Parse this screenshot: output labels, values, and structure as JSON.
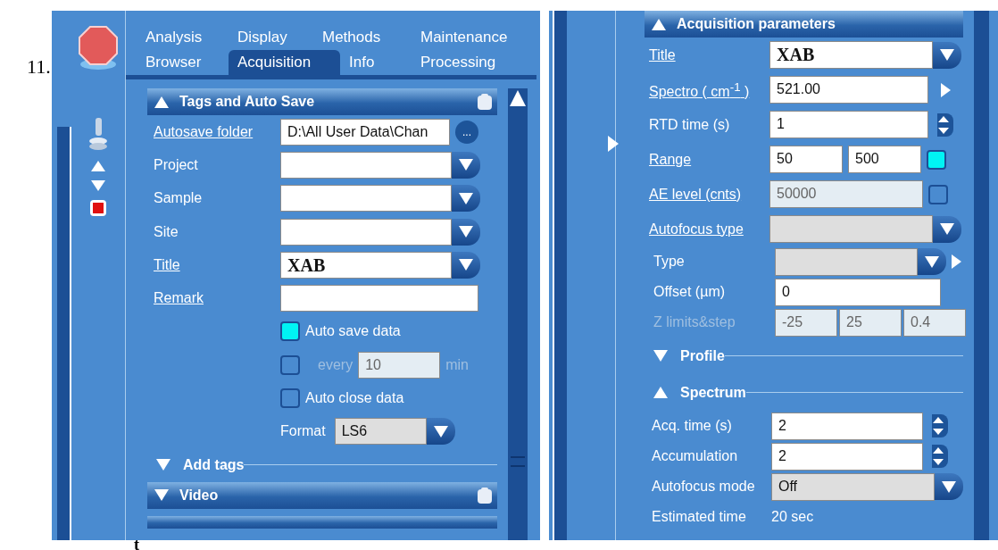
{
  "list_number": "11.",
  "left_panel": {
    "tab_rows": [
      [
        {
          "label": "Analysis",
          "selected": false
        },
        {
          "label": "Display",
          "selected": false
        },
        {
          "label": "Methods",
          "selected": false
        },
        {
          "label": "Maintenance",
          "selected": false
        }
      ],
      [
        {
          "label": "Browser",
          "selected": false
        },
        {
          "label": "Acquisition",
          "selected": true
        },
        {
          "label": "Info",
          "selected": false
        },
        {
          "label": "Processing",
          "selected": false
        }
      ]
    ],
    "tags_section": {
      "title": "Tags and Auto Save",
      "expanded": true
    },
    "rows": [
      {
        "kind": "path",
        "label": "Autosave folder",
        "link": true,
        "value": "D:\\All User Data\\Chan",
        "button": "..."
      },
      {
        "kind": "combo",
        "label": "Project",
        "link": false,
        "disabled": false
      },
      {
        "kind": "combo",
        "label": "Sample",
        "link": false,
        "disabled": false
      },
      {
        "kind": "combo",
        "label": "Site",
        "link": false,
        "disabled": false
      },
      {
        "kind": "combo",
        "label": "Title",
        "link": true,
        "disabled": false,
        "value": "XAB",
        "stamp": true
      },
      {
        "kind": "text",
        "label": "Remark",
        "link": true
      },
      {
        "kind": "check",
        "label": "Auto save data",
        "checked": true
      },
      {
        "kind": "interval",
        "label": "every",
        "checked": false,
        "disabled": true,
        "value": "10",
        "unit": "min"
      },
      {
        "kind": "check",
        "label": "Auto close data",
        "checked": false
      },
      {
        "kind": "format",
        "label": "Format",
        "value": "LS6"
      }
    ],
    "add_tags": {
      "title": "Add tags",
      "expanded": false
    },
    "video_section": {
      "title": "Video",
      "expanded": false
    }
  },
  "right_panel": {
    "section": {
      "title": "Acquisition parameters",
      "expanded": true
    },
    "rows": [
      {
        "kind": "combo",
        "label": "Title",
        "link": true,
        "disabled": false,
        "value": "XAB",
        "stamp": true
      },
      {
        "kind": "arrow",
        "label": "Spectro ( cm$^{-1}$ )",
        "link": true,
        "value": "521.00"
      },
      {
        "kind": "spin",
        "label": "RTD time (s)",
        "link": false,
        "value": "1"
      },
      {
        "kind": "range",
        "label": "Range",
        "link": true,
        "values": [
          "50",
          "500"
        ],
        "checked": true
      },
      {
        "kind": "level",
        "label": "AE level (cnts)",
        "link": true,
        "value": "50000",
        "disabled": true,
        "checked": false
      },
      {
        "kind": "combo",
        "label": "Autofocus type",
        "link": true,
        "disabled": true
      }
    ],
    "autofocus_rows": [
      {
        "kind": "combo_next",
        "label": "Type",
        "link": false,
        "disabled": true
      },
      {
        "kind": "text",
        "label": "Offset (µm)",
        "link": false,
        "value": "0"
      },
      {
        "kind": "triple",
        "label": "Z limits&step",
        "link": false,
        "disabled": true,
        "values": [
          "-25",
          "25",
          "0.4"
        ]
      }
    ],
    "profile": {
      "title": "Profile",
      "expanded": false
    },
    "spectrum": {
      "title": "Spectrum",
      "expanded": true
    },
    "spectrum_rows": [
      {
        "kind": "spin",
        "label": "Acq. time (s)",
        "link": false,
        "value": "2"
      },
      {
        "kind": "spin",
        "label": "Accumulation",
        "link": false,
        "value": "2"
      },
      {
        "kind": "select",
        "label": "Autofocus mode",
        "link": false,
        "value": "Off"
      },
      {
        "kind": "info",
        "label": "Estimated time",
        "link": false,
        "value": "20 sec"
      }
    ]
  },
  "fragment": "t"
}
